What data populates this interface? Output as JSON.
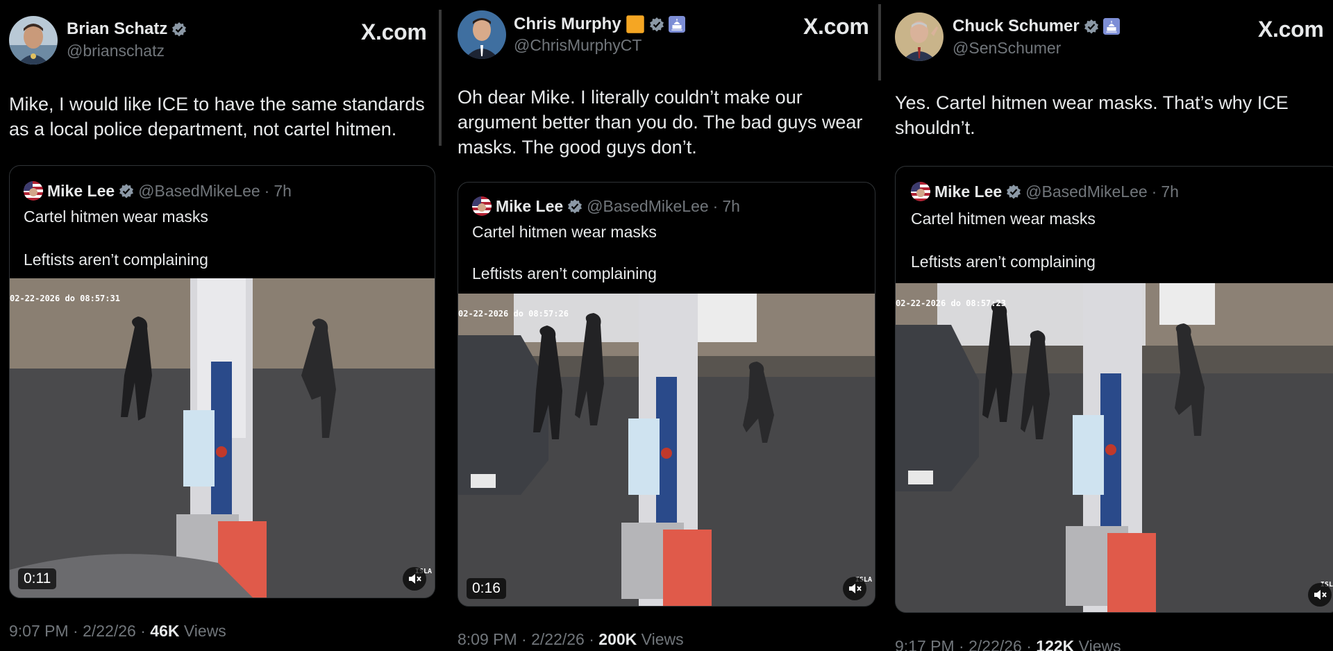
{
  "colors": {
    "background": "#000000",
    "text": "#e7e9ea",
    "muted": "#71767b",
    "verified": "#1d9bf0",
    "border": "#2f3336"
  },
  "posts": [
    {
      "author": {
        "name": "Brian Schatz",
        "handle": "@brianschatz",
        "badges": [
          "verified-icon"
        ]
      },
      "source": "X.com",
      "text": "Mike, I would like ICE to have the same standards as a local police department, not cartel hitmen.",
      "quote": {
        "name": "Mike Lee",
        "handle": "@BasedMikeLee",
        "time": "7h",
        "line1": "Cartel hitmen wear masks",
        "line2": "Leftists aren’t complaining",
        "video_stamp": "02-22-2026 do  08:57:31",
        "duration": "0:11"
      },
      "meta": {
        "time": "9:07 PM · 2/22/26 ·",
        "views_count": "46K",
        "views_label": "Views"
      }
    },
    {
      "author": {
        "name": "Chris Murphy",
        "handle": "@ChrisMurphyCT",
        "badges": [
          "orange-square-emoji",
          "verified-icon",
          "capitol-icon"
        ]
      },
      "source": "X.com",
      "text": "Oh dear Mike. I literally couldn’t make our argument better than you do. The bad guys wear masks. The good guys don’t.",
      "quote": {
        "name": "Mike Lee",
        "handle": "@BasedMikeLee",
        "time": "7h",
        "line1": "Cartel hitmen wear masks",
        "line2": "Leftists aren’t complaining",
        "video_stamp": "02-22-2026 do  08:57:26",
        "duration": "0:16"
      },
      "meta": {
        "time": "8:09 PM · 2/22/26 ·",
        "views_count": "200K",
        "views_label": "Views"
      }
    },
    {
      "author": {
        "name": "Chuck Schumer",
        "handle": "@SenSchumer",
        "badges": [
          "verified-icon",
          "capitol-icon"
        ]
      },
      "source": "X.com",
      "text": "Yes. Cartel hitmen wear masks. That’s why ICE shouldn’t.",
      "quote": {
        "name": "Mike Lee",
        "handle": "@BasedMikeLee",
        "time": "7h",
        "line1": "Cartel hitmen wear masks",
        "line2": "Leftists aren’t complaining",
        "video_stamp": "02-22-2026 do  08:57:23",
        "duration": ""
      },
      "meta": {
        "time": "9:17 PM · 2/22/26 ·",
        "views_count": "122K",
        "views_label": "Views"
      }
    }
  ],
  "watermark": "ISLA"
}
